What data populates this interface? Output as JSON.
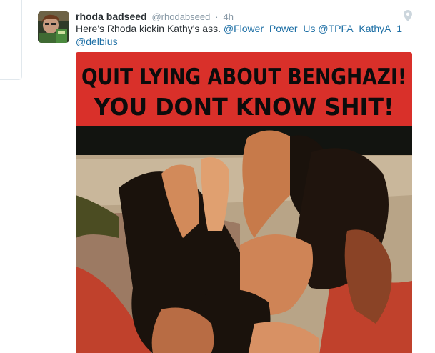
{
  "tweet": {
    "fullname": "rhoda badseed",
    "username": "@rhodabseed",
    "separator": "·",
    "time": "4h",
    "text_prefix": "Here's Rhoda kickin Kathy's ass. ",
    "mentions": [
      "@Flower_Power_Us",
      "@TPFA_KathyA_1",
      "@delbius"
    ],
    "icons": {
      "location": "map-pin-icon"
    },
    "media": {
      "caption_line1": "QUIT LYING ABOUT BENGHAZI!",
      "caption_line2": "YOU DONT KNOW SHIT!",
      "banner_color": "#d9302a"
    }
  }
}
